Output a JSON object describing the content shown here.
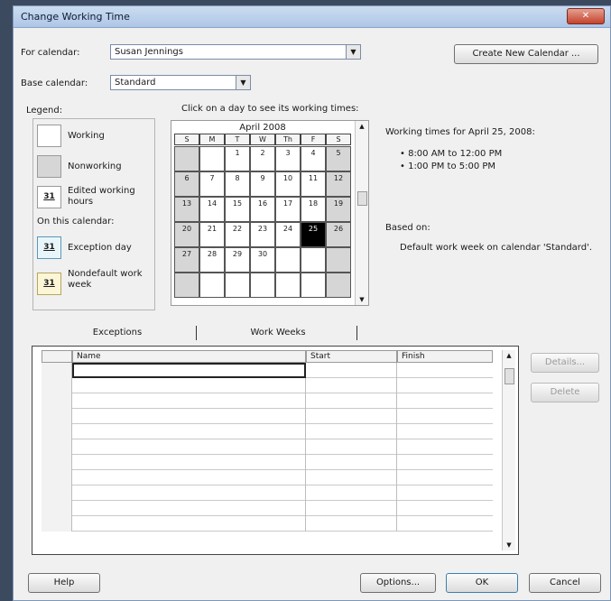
{
  "window": {
    "title": "Change Working Time",
    "close": "✕"
  },
  "for_calendar": {
    "label": "For calendar:",
    "value": "Susan Jennings"
  },
  "base_calendar": {
    "label": "Base calendar:",
    "value": "Standard"
  },
  "buttons": {
    "create_new": "Create New Calendar ...",
    "details": "Details...",
    "delete": "Delete",
    "help": "Help",
    "options": "Options...",
    "ok": "OK",
    "cancel": "Cancel"
  },
  "legend": {
    "title": "Legend:",
    "working": "Working",
    "nonworking": "Nonworking",
    "edited": "Edited working hours",
    "on_this_calendar": "On this calendar:",
    "exception_day": "Exception day",
    "nondefault": "Nondefault work week",
    "sample_day": "31"
  },
  "calendar": {
    "instruction": "Click on a day to see its working times:",
    "month": "April 2008",
    "weekdays": [
      "S",
      "M",
      "T",
      "W",
      "Th",
      "F",
      "S"
    ],
    "weeks": [
      [
        "",
        "",
        "1",
        "2",
        "3",
        "4",
        "5"
      ],
      [
        "6",
        "7",
        "8",
        "9",
        "10",
        "11",
        "12"
      ],
      [
        "13",
        "14",
        "15",
        "16",
        "17",
        "18",
        "19"
      ],
      [
        "20",
        "21",
        "22",
        "23",
        "24",
        "25",
        "26"
      ],
      [
        "27",
        "28",
        "29",
        "30",
        "",
        "",
        ""
      ],
      [
        "",
        "",
        "",
        "",
        "",
        "",
        ""
      ]
    ],
    "selected_day": "25"
  },
  "working_times": {
    "heading": "Working times for April 25, 2008:",
    "times": [
      "• 8:00 AM to 12:00 PM",
      "• 1:00 PM to 5:00 PM"
    ],
    "based_on_label": "Based on:",
    "based_on_text": "Default work week on calendar 'Standard'."
  },
  "tabs": {
    "exceptions": "Exceptions",
    "work_weeks": "Work Weeks"
  },
  "exceptions_table": {
    "columns": [
      "Name",
      "Start",
      "Finish"
    ],
    "row_count": 11
  },
  "colors": {
    "nonworking": "#d6d6d6",
    "selected": "#000000",
    "exception": "#e8f6fb",
    "nondefault": "#fbf6d6"
  }
}
